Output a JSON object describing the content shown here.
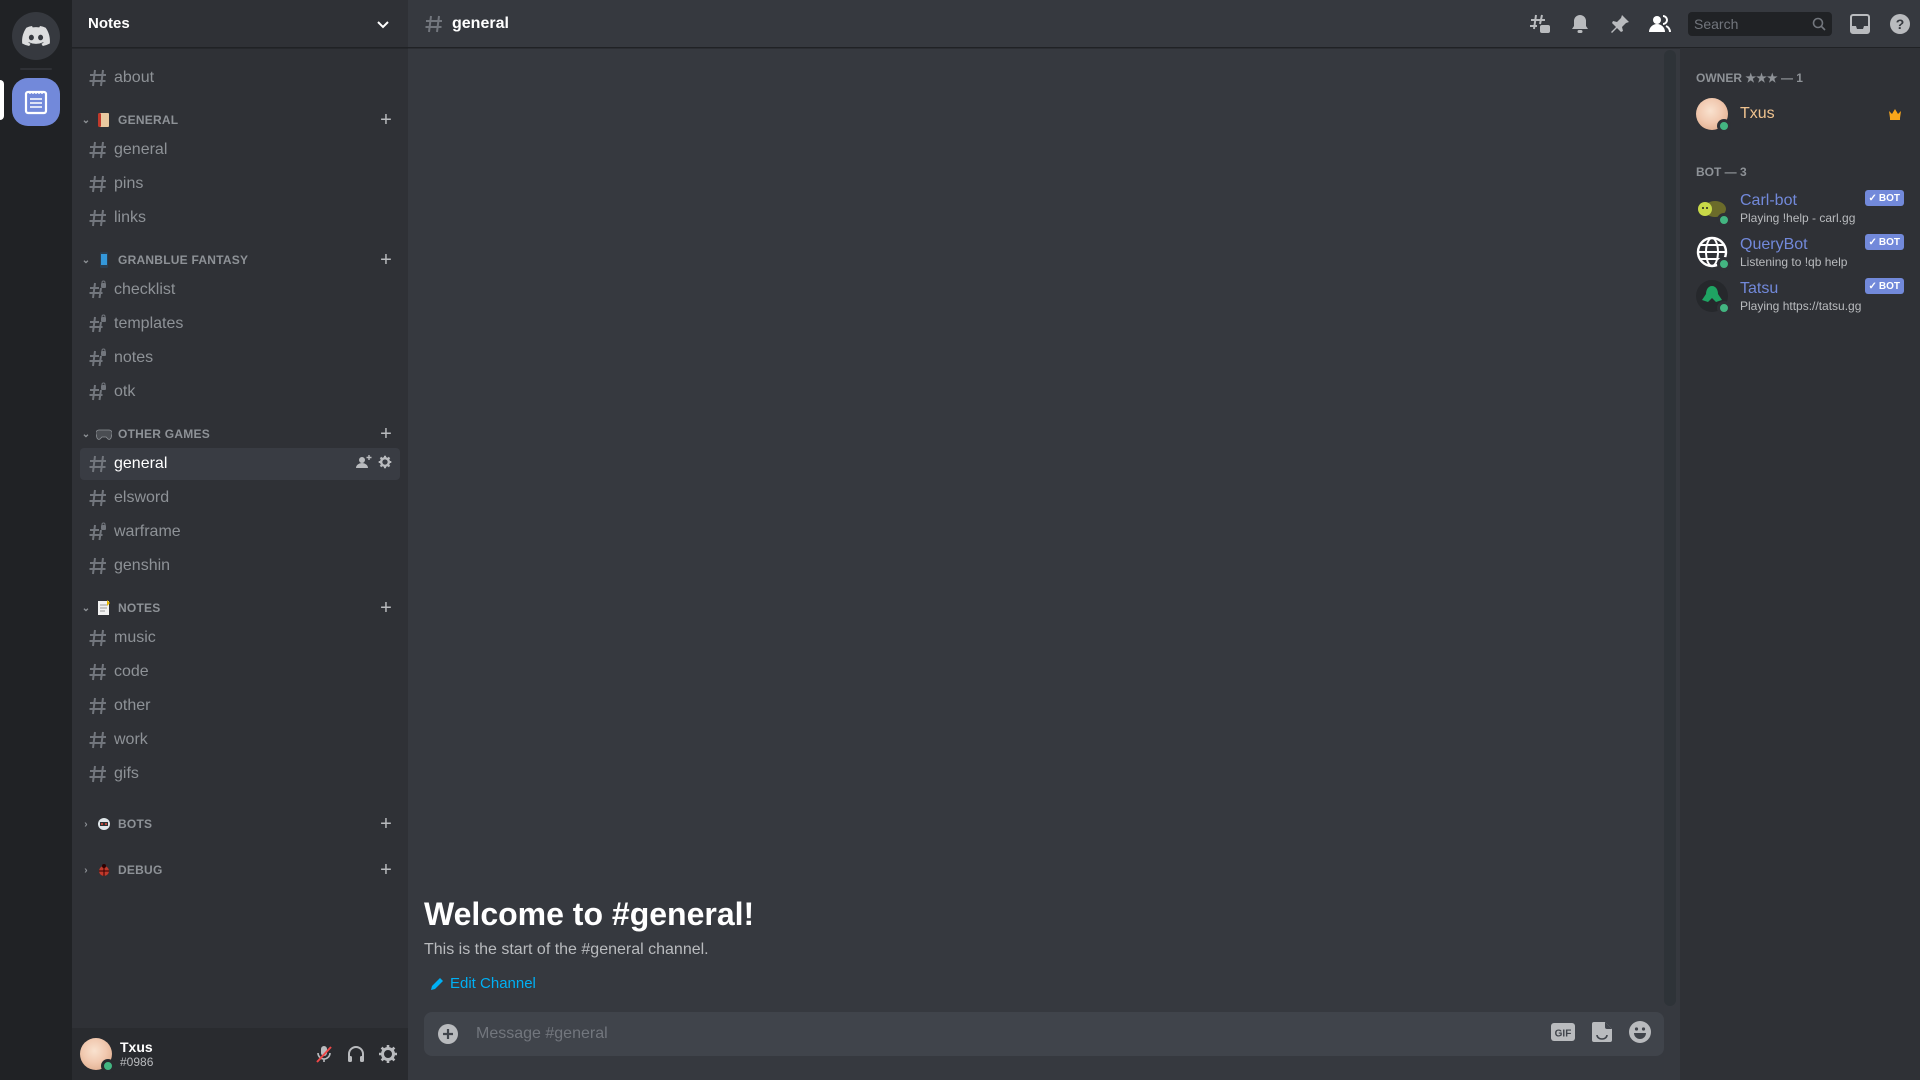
{
  "server_rail": {
    "home_icon": "discord-logo-icon",
    "servers": [
      {
        "name": "Notes",
        "icon": "notepad-icon",
        "active": true
      }
    ]
  },
  "sidebar": {
    "guild_name": "Notes",
    "top_channels": [
      {
        "name": "about",
        "locked": false
      }
    ],
    "categories": [
      {
        "name": "GENERAL",
        "emoji": "scroll",
        "collapsed": false,
        "channels": [
          {
            "name": "general",
            "locked": false
          },
          {
            "name": "pins",
            "locked": false
          },
          {
            "name": "links",
            "locked": false
          }
        ]
      },
      {
        "name": "GRANBLUE FANTASY",
        "emoji": "mobile-phone",
        "collapsed": false,
        "channels": [
          {
            "name": "checklist",
            "locked": true
          },
          {
            "name": "templates",
            "locked": true
          },
          {
            "name": "notes",
            "locked": true
          },
          {
            "name": "otk",
            "locked": true
          }
        ]
      },
      {
        "name": "OTHER GAMES",
        "emoji": "game-controller",
        "collapsed": false,
        "channels": [
          {
            "name": "general",
            "locked": false,
            "selected": true
          },
          {
            "name": "elsword",
            "locked": false
          },
          {
            "name": "warframe",
            "locked": true
          },
          {
            "name": "genshin",
            "locked": false
          }
        ]
      },
      {
        "name": "NOTES",
        "emoji": "memo",
        "collapsed": false,
        "channels": [
          {
            "name": "music",
            "locked": false
          },
          {
            "name": "code",
            "locked": false
          },
          {
            "name": "other",
            "locked": false
          },
          {
            "name": "work",
            "locked": false
          },
          {
            "name": "gifs",
            "locked": false
          }
        ]
      },
      {
        "name": "BOTS",
        "emoji": "robot",
        "collapsed": true,
        "channels": []
      },
      {
        "name": "DEBUG",
        "emoji": "bug",
        "collapsed": true,
        "channels": []
      }
    ]
  },
  "user": {
    "name": "Txus",
    "discriminator": "#0986",
    "status": "online"
  },
  "header": {
    "channel": "general",
    "search_placeholder": "Search",
    "icons": [
      "threads-icon",
      "bell-icon",
      "pin-icon",
      "members-icon",
      "inbox-icon",
      "help-icon"
    ]
  },
  "chat": {
    "welcome_title": "Welcome to #general!",
    "welcome_sub": "This is the start of the #general channel.",
    "edit_label": "Edit Channel",
    "message_placeholder": "Message #general",
    "gif_label": "GIF"
  },
  "members": {
    "groups": [
      {
        "title": "OWNER ★★★ — 1",
        "members": [
          {
            "name": "Txus",
            "color": "#f0c38f",
            "activity": "",
            "bot": false,
            "crown": true
          }
        ]
      },
      {
        "title": "BOT — 3",
        "members": [
          {
            "name": "Carl-bot",
            "color": "#7289da",
            "activity": "Playing !help - carl.gg",
            "bot": true
          },
          {
            "name": "QueryBot",
            "color": "#7289da",
            "activity": "Listening to !qb help",
            "bot": true
          },
          {
            "name": "Tatsu",
            "color": "#7289da",
            "activity": "Playing https://tatsu.gg",
            "bot": true
          }
        ]
      }
    ],
    "bot_badge": "BOT"
  },
  "colors": {
    "accent": "#7289da",
    "online": "#43b581",
    "link": "#00b0f4",
    "owner": "#f0c38f"
  }
}
